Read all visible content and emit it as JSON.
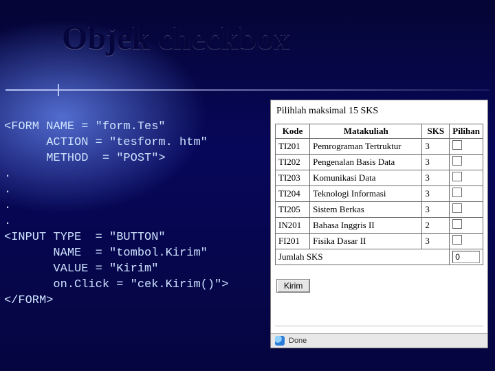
{
  "title": "Objek checkbox",
  "code_lines": [
    "<FORM NAME = \"form.Tes\"",
    "      ACTION = \"tesform. htm\"",
    "      METHOD  = \"POST\">",
    ".",
    ".",
    ".",
    ".",
    "<INPUT TYPE  = \"BUTTON\"",
    "       NAME  = \"tombol.Kirim\"",
    "       VALUE = \"Kirim\"",
    "       on.Click = \"cek.Kirim()\">",
    "</FORM>"
  ],
  "panel": {
    "instruction": "Pilihlah maksimal 15 SKS",
    "headers": {
      "kode": "Kode",
      "mk": "Matakuliah",
      "sks": "SKS",
      "pilihan": "Pilihan"
    },
    "rows": [
      {
        "kode": "TI201",
        "mk": "Pemrograman Tertruktur",
        "sks": "3"
      },
      {
        "kode": "TI202",
        "mk": "Pengenalan Basis Data",
        "sks": "3"
      },
      {
        "kode": "TI203",
        "mk": "Komunikasi Data",
        "sks": "3"
      },
      {
        "kode": "TI204",
        "mk": "Teknologi Informasi",
        "sks": "3"
      },
      {
        "kode": "TI205",
        "mk": "Sistem Berkas",
        "sks": "3"
      },
      {
        "kode": "IN201",
        "mk": "Bahasa Inggris II",
        "sks": "2"
      },
      {
        "kode": "FI201",
        "mk": "Fisika Dasar II",
        "sks": "3"
      }
    ],
    "sum_label": "Jumlah SKS",
    "sum_value": "0",
    "button_label": "Kirim",
    "status_text": "Done"
  }
}
